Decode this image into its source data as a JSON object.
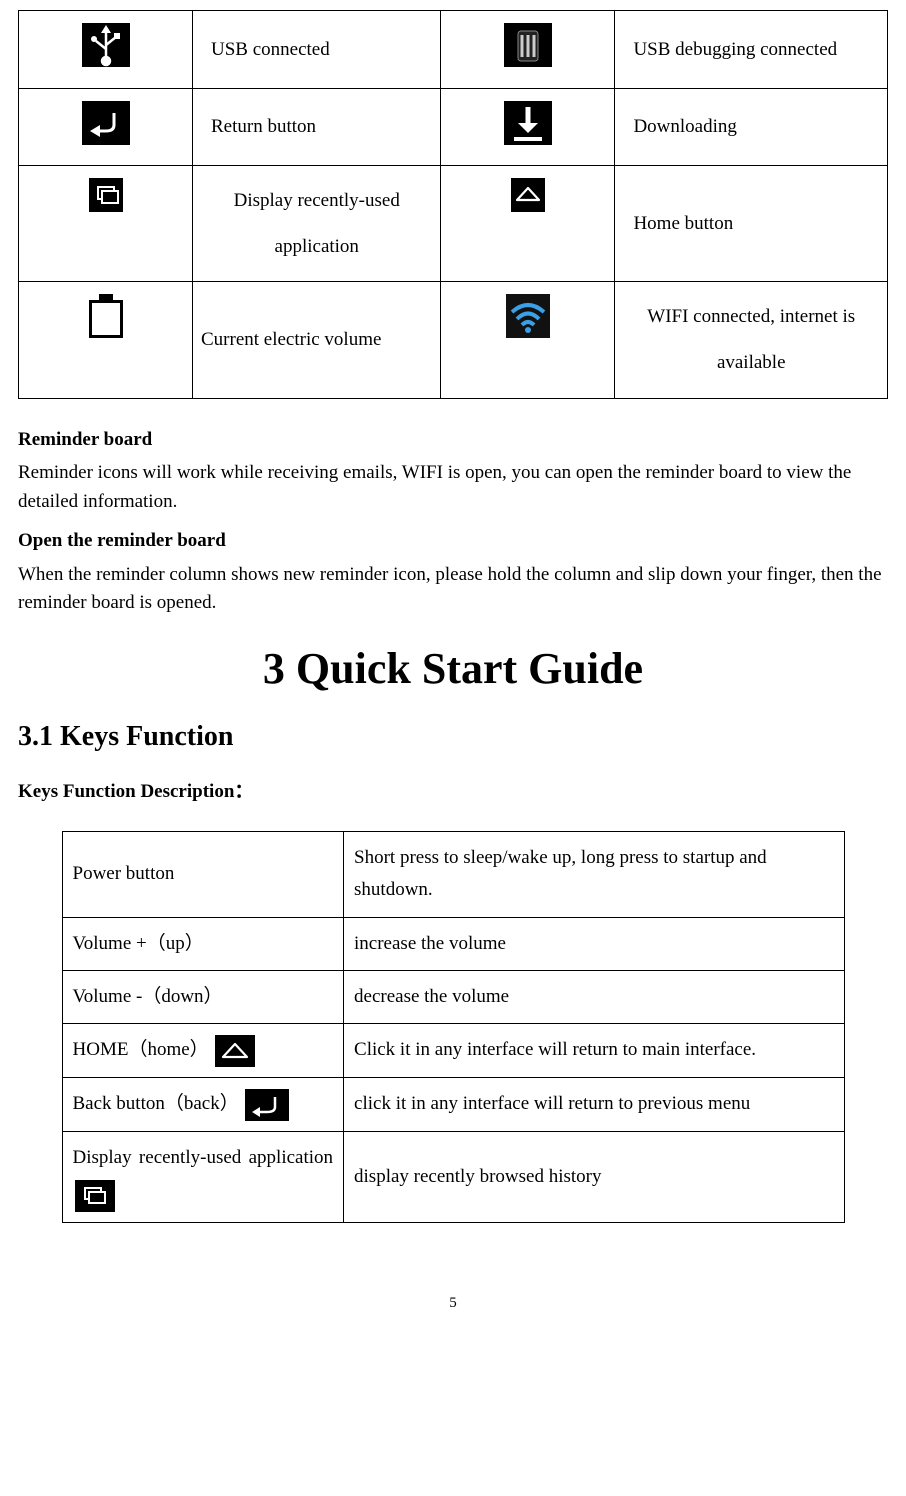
{
  "iconTable": {
    "r1c1_desc": "USB connected",
    "r1c2_desc": "USB debugging connected",
    "r2c1_desc": "Return button",
    "r2c2_desc": "Downloading",
    "r3c1_desc": "Display recently-used application",
    "r3c2_desc": "Home button",
    "r4c1_desc": "Current electric volume",
    "r4c2_desc": "WIFI connected, internet is available"
  },
  "reminder": {
    "heading": "Reminder board",
    "text": "Reminder icons will work while receiving emails, WIFI is open, you can open the reminder board to view the detailed information.",
    "openHeading": "Open the reminder board",
    "openText": "When the reminder column shows new reminder icon, please hold the column and slip down your finger, then the reminder board is opened."
  },
  "chapter": "3 Quick Start Guide",
  "section": "3.1 Keys Function",
  "keysSubhead": "Keys Function Description：",
  "keysTable": {
    "r1": {
      "key": "Power button",
      "val": "Short press to sleep/wake up, long press to startup and shutdown."
    },
    "r2": {
      "key": "Volume +（up）",
      "val": "increase the volume"
    },
    "r3": {
      "key": "Volume -（down）",
      "val": "decrease the volume"
    },
    "r4": {
      "key": "HOME（home）",
      "val": "Click it in any interface will return to main interface."
    },
    "r5": {
      "key": "Back button（back）",
      "val": "click it in any interface will return to previous menu"
    },
    "r6": {
      "key": "Display recently-used application",
      "val": "display recently browsed history"
    }
  },
  "pageNumber": "5"
}
